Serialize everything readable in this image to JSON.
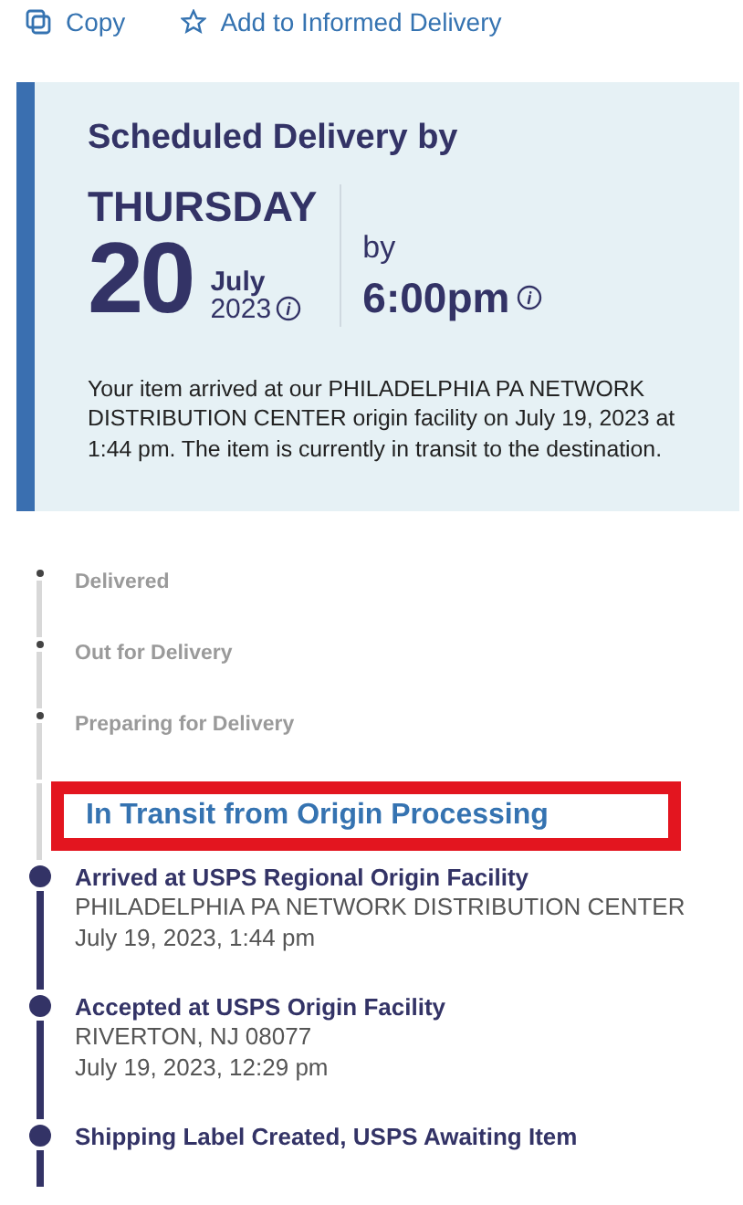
{
  "actions": [
    {
      "label": "Copy"
    },
    {
      "label": "Add to Informed Delivery"
    }
  ],
  "delivery": {
    "title": "Scheduled Delivery by",
    "weekday": "THURSDAY",
    "day": "20",
    "month": "July",
    "year": "2023",
    "by_label": "by",
    "time": "6:00pm",
    "message": "Your item arrived at our PHILADELPHIA PA NETWORK DISTRIBUTION CENTER origin facility on July 19, 2023 at 1:44 pm. The item is currently in transit to the destination."
  },
  "upcoming": [
    {
      "title": "Delivered"
    },
    {
      "title": "Out for Delivery"
    },
    {
      "title": "Preparing for Delivery"
    }
  ],
  "current_status": {
    "text": "In Transit from Origin Processing",
    "highlighted": true
  },
  "history": [
    {
      "title": "Arrived at USPS Regional Origin Facility",
      "location": "PHILADELPHIA PA NETWORK DISTRIBUTION CENTER",
      "datetime": "July 19, 2023, 1:44 pm"
    },
    {
      "title": "Accepted at USPS Origin Facility",
      "location": "RIVERTON, NJ 08077",
      "datetime": "July 19, 2023, 12:29 pm"
    },
    {
      "title": "Shipping Label Created, USPS Awaiting Item"
    }
  ]
}
